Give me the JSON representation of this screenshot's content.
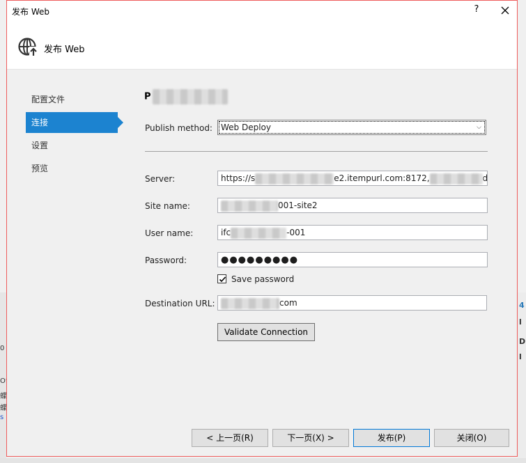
{
  "window": {
    "title": "发布 Web",
    "help_glyph": "?",
    "close_icon": "close-icon"
  },
  "header": {
    "icon": "globe-publish-icon",
    "title": "发布 Web"
  },
  "nav": {
    "items": [
      {
        "label": "配置文件",
        "active": false
      },
      {
        "label": "连接",
        "active": true
      },
      {
        "label": "设置",
        "active": false
      },
      {
        "label": "预览",
        "active": false
      }
    ]
  },
  "profile": {
    "name_visible_prefix": "P"
  },
  "form": {
    "publish_method_label": "Publish method:",
    "publish_method_value": "Web Deploy",
    "server_label": "Server:",
    "server_value_prefix": "https://s",
    "server_value_middle": "e2.itempurl.com:8172,",
    "server_value_suffix": "d",
    "site_name_label": "Site name:",
    "site_name_value_suffix": "001-site2",
    "user_name_label": "User name:",
    "user_name_value_prefix": "ifc",
    "user_name_value_suffix": "-001",
    "password_label": "Password:",
    "password_value": "●●●●●●●●●",
    "save_password_label": "Save password",
    "save_password_checked": true,
    "destination_url_label": "Destination URL:",
    "destination_url_value_suffix": "com",
    "validate_button": "Validate Connection"
  },
  "footer": {
    "prev_button": "< 上一页(R)",
    "next_button": "下一页(X) >",
    "publish_button": "发布(P)",
    "close_button": "关闭(O)"
  },
  "colors": {
    "accent": "#1c83d0",
    "dialog_border": "#ee5b5b"
  }
}
